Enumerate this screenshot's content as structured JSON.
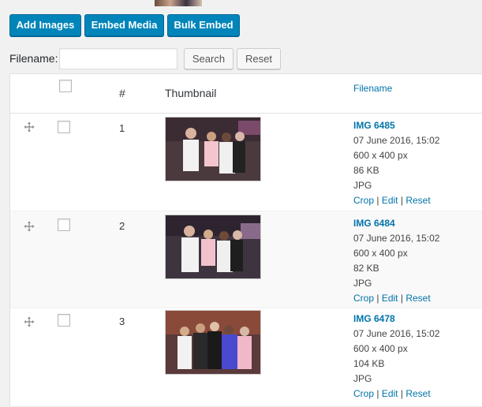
{
  "toolbar": {
    "add_images": "Add Images",
    "embed_media": "Embed Media",
    "bulk_embed": "Bulk Embed"
  },
  "search": {
    "label": "Filename:",
    "value": "",
    "placeholder": "",
    "search_button": "Search",
    "reset_button": "Reset"
  },
  "table": {
    "headers": {
      "number": "#",
      "thumbnail": "Thumbnail",
      "filename": "Filename"
    },
    "rows": [
      {
        "number": "1",
        "filename": "IMG 6485",
        "date": "07 June 2016, 15:02",
        "dimensions": "600 x 400 px",
        "size": "86 KB",
        "type": "JPG",
        "actions": {
          "crop": "Crop",
          "edit": "Edit",
          "reset": "Reset",
          "sep": "|"
        }
      },
      {
        "number": "2",
        "filename": "IMG 6484",
        "date": "07 June 2016, 15:02",
        "dimensions": "600 x 400 px",
        "size": "82 KB",
        "type": "JPG",
        "actions": {
          "crop": "Crop",
          "edit": "Edit",
          "reset": "Reset",
          "sep": "|"
        }
      },
      {
        "number": "3",
        "filename": "IMG 6478",
        "date": "07 June 2016, 15:02",
        "dimensions": "600 x 400 px",
        "size": "104 KB",
        "type": "JPG",
        "actions": {
          "crop": "Crop",
          "edit": "Edit",
          "reset": "Reset",
          "sep": "|"
        }
      }
    ]
  },
  "colors": {
    "primary_button": "#0085ba",
    "link": "#0073aa",
    "background": "#f1f1f1"
  },
  "icons": {
    "drag": "move-arrows-icon"
  }
}
